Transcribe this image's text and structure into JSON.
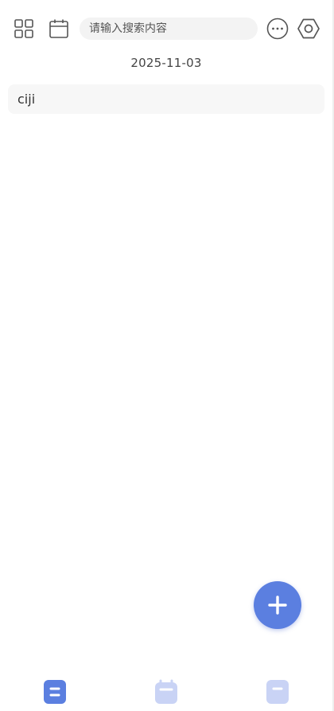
{
  "header": {
    "icons": {
      "grid": "grid-icon",
      "calendar": "calendar-icon",
      "more": "more-dots-icon",
      "settings": "settings-hexagon-icon"
    },
    "search": {
      "placeholder": "请输入搜索内容",
      "value": ""
    }
  },
  "date": "2025-11-03",
  "entries": [
    {
      "title": "ciji"
    }
  ],
  "fab": {
    "icon": "plus-icon",
    "color": "#5b7fe0"
  },
  "bottom_nav": {
    "items": [
      {
        "icon": "list-tab-icon",
        "active": true,
        "color": "#5b7fe0"
      },
      {
        "icon": "calendar-tab-icon",
        "active": false,
        "color": "#c9d3f5"
      },
      {
        "icon": "note-tab-icon",
        "active": false,
        "color": "#c9d3f5"
      }
    ]
  },
  "colors": {
    "accent": "#5b7fe0",
    "accent_light": "#c9d3f5",
    "search_bg": "#f3f3f3",
    "card_bg": "#f7f7f7"
  }
}
